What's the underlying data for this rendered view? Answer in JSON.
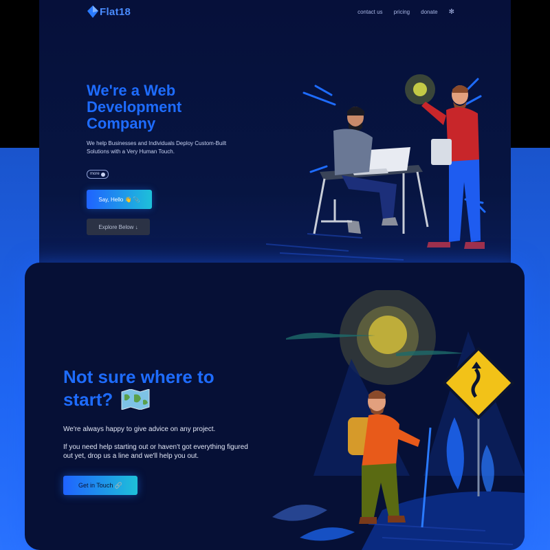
{
  "nav": {
    "logo_text": "Flat18",
    "links": [
      "contact us",
      "pricing",
      "donate"
    ],
    "settings_icon": "gear-icon"
  },
  "hero": {
    "title": "We're a Web Development Company",
    "subtitle": "We help Businesses and Individuals Deploy Custom-Built Solutions with a Very Human Touch.",
    "more_label": "more",
    "primary_button": "Say, Hello 👋 📎",
    "secondary_button": "Explore Below ↓"
  },
  "section2": {
    "title": "Not sure where to start?",
    "title_icon": "map-icon",
    "text1": "We're always happy to give advice on any project.",
    "text2": "If you need help starting out or haven't got everything figured out yet, drop us a line and we'll help you out.",
    "button": "Get in Touch 🔗"
  },
  "colors": {
    "accent": "#1e6cff",
    "gradient_end": "#1ec0d9",
    "panel_bg": "#061036",
    "page_blue": "#1c5fe0"
  }
}
